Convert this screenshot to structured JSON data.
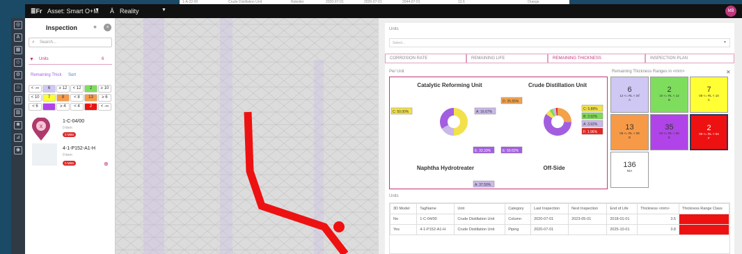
{
  "strip": {
    "c1": "1-A-22-00",
    "c2": "Crude Distillation Unit",
    "c3": "Reboiler",
    "c4": "2020-07-01",
    "c5": "2026-07-01",
    "c6": "2044-07-01",
    "c7": "12.6",
    "c8": "Orange"
  },
  "topbar": {
    "logo": "≣Fr",
    "asset": "Asset: Smart O+M",
    "mode": "Reality",
    "avatar": "MB",
    "colors": {
      "bg": "#111111",
      "avatar": "#c0367c"
    }
  },
  "panel": {
    "title": "Inspection",
    "search_placeholder": "Search...",
    "units_label": "Units",
    "units_count": "6",
    "remaining_label": "Remaining Thick",
    "sort_label": "Sort",
    "grid": [
      [
        "< -∞",
        "6",
        "≥ 12",
        "< 12",
        "2",
        "≥ 10"
      ],
      [
        "< 10",
        "7",
        "8",
        "< 8",
        "13",
        "≥ 6"
      ],
      [
        "< 6",
        "",
        "≥ 4",
        "< 4",
        "2",
        "< -∞"
      ]
    ],
    "items": [
      {
        "tag": "1-C-04/00",
        "sub": "0 item",
        "badge": "0 MB5"
      },
      {
        "tag": "4-1-P152-A1-H",
        "sub": "0 item",
        "badge": "0 MB5"
      }
    ]
  },
  "right": {
    "units_label": "Units",
    "units_placeholder": "Select...",
    "tabs": [
      "CORROSION RATE",
      "REMAINING LIFE",
      "REMAINING THICKNESS",
      "INSPECTION PLAN"
    ],
    "per_unit": "Per Unit",
    "ranges_title": "Remaining Thickness Ranges in <mm>",
    "units_table_label": "Units"
  },
  "chart_data": {
    "type": "pie",
    "charts": [
      {
        "title": "Catalytic Reforming Unit",
        "labels": [
          "C: 50.00%",
          "A: 16.67%",
          "E: 33.33%"
        ],
        "values": [
          50,
          16.67,
          33.33
        ],
        "colors": [
          "#f2e14a",
          "#c9b8e8",
          "#a35ee0"
        ]
      },
      {
        "title": "Crude Distillation Unit",
        "labels": [
          "D: 25.55%",
          "E: 59.62%",
          "C: 5.88%",
          "B: 3.92%",
          "A: 3.92%",
          "F: 1.96%"
        ],
        "values": [
          25.55,
          59.62,
          5.88,
          3.92,
          3.92,
          1.96
        ],
        "colors": [
          "#f3a24a",
          "#a35ee0",
          "#f2e14a",
          "#7ed957",
          "#c9b8e8",
          "#e8231d"
        ]
      },
      {
        "title": "Naphtha Hydrotreater",
        "labels": [
          "A: 37.50%"
        ],
        "values": [
          37.5
        ],
        "colors": [
          "#c9b8e8"
        ]
      },
      {
        "title": "Off-Side",
        "labels": [],
        "values": [],
        "colors": []
      }
    ]
  },
  "ranges": [
    {
      "n": "6",
      "r": "12 <= RL < inf",
      "c": "A",
      "bg": "#cfc8f5"
    },
    {
      "n": "2",
      "r": "10 <= RL < 12",
      "c": "B",
      "bg": "#7fdd5e"
    },
    {
      "n": "7",
      "r": "08 <= RL < 10",
      "c": "C",
      "bg": "#ffff33"
    },
    {
      "n": "13",
      "r": "06 <= RL < 08",
      "c": "D",
      "bg": "#f79a47"
    },
    {
      "n": "35",
      "r": "04 <= RL < 06",
      "c": "E",
      "bg": "#b044e8"
    },
    {
      "n": "2",
      "r": "00 <= RL < 04",
      "c": "F",
      "bg": "#ee1111"
    },
    {
      "n": "136",
      "r": "N/A",
      "c": "",
      "bg": "#ffffff"
    }
  ],
  "table": {
    "headers": [
      "3D Model",
      "TagName",
      "Unit",
      "Category",
      "Last Inspection",
      "Next Inspection",
      "End of Life",
      "Thickness <mm>",
      "Thickness Range Class"
    ],
    "rows": [
      [
        "No",
        "1-C-04/00",
        "Crude Distillation Unit",
        "Column",
        "2020-07-01",
        "2023-05-01",
        "2018-01-01",
        "3.5",
        ""
      ],
      [
        "Yes",
        "4-1-P152-A1-H",
        "Crude Distillation Unit",
        "Piping",
        "2020-07-01",
        "",
        "2025-10-01",
        "3.8",
        ""
      ]
    ]
  }
}
